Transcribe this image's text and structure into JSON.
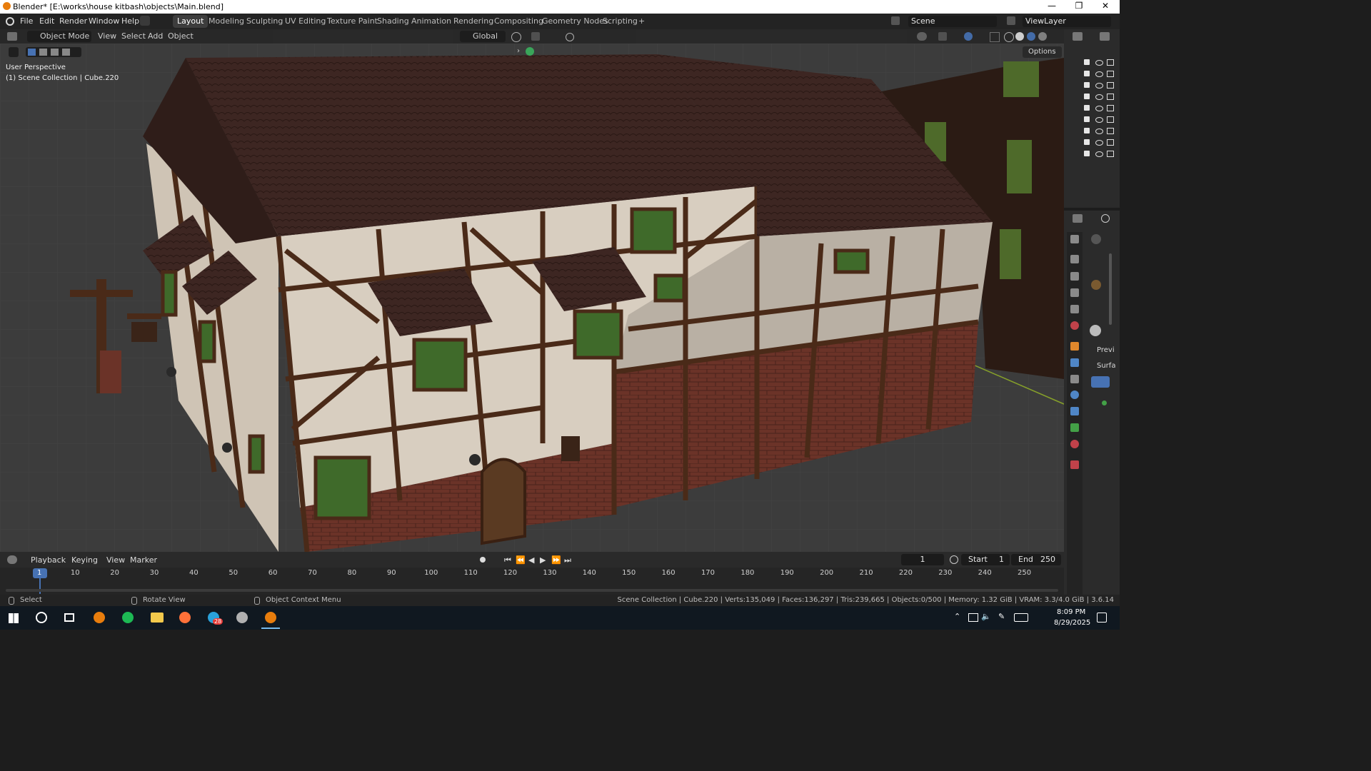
{
  "window": {
    "title": "Blender* [E:\\works\\house kitbash\\objects\\Main.blend]",
    "controls": [
      "—",
      "❐",
      "✕"
    ]
  },
  "menu": [
    "File",
    "Edit",
    "Render",
    "Window",
    "Help"
  ],
  "workspaces": [
    "Layout",
    "Modeling",
    "Sculpting",
    "UV Editing",
    "Texture Paint",
    "Shading",
    "Animation",
    "Rendering",
    "Compositing",
    "Geometry Nodes",
    "Scripting",
    "+"
  ],
  "active_workspace": "Layout",
  "scene": {
    "label": "Scene",
    "view_layer": "ViewLayer"
  },
  "viewport_header": {
    "mode": "Object Mode",
    "menus": [
      "View",
      "Select",
      "Add",
      "Object"
    ],
    "transform_orientation": "Global",
    "options": "Options"
  },
  "viewport": {
    "perspective": "User Perspective",
    "collection_info": "(1) Scene Collection | Cube.220"
  },
  "properties_tabs": [
    "Previ",
    "Surfa"
  ],
  "timeline_header": {
    "menus": [
      "Playback",
      "Keying",
      "View",
      "Marker"
    ],
    "current_frame": "1",
    "start_label": "Start",
    "start": "1",
    "end_label": "End",
    "end": "250"
  },
  "timeline_ticks": [
    "1",
    "10",
    "20",
    "30",
    "40",
    "50",
    "60",
    "70",
    "80",
    "90",
    "100",
    "110",
    "120",
    "130",
    "140",
    "150",
    "160",
    "170",
    "180",
    "190",
    "200",
    "210",
    "220",
    "230",
    "240",
    "250"
  ],
  "statusbar": {
    "select": "Select",
    "rotate": "Rotate View",
    "context": "Object Context Menu",
    "stats": "Scene Collection | Cube.220 | Verts:135,049 | Faces:136,297 | Tris:239,665 | Objects:0/500 | Memory: 1.32 GiB | VRAM: 3.3/4.0 GiB | 3.6.14"
  },
  "taskbar": {
    "time": "8:09 PM",
    "date": "8/29/2025",
    "badge": "28"
  },
  "colors": {
    "accent": "#4772b3",
    "wall": "#d8cec0",
    "timber": "#4a2a18",
    "roof": "#3d2622",
    "brick": "#6b3328",
    "glass": "#3f6a2a"
  }
}
